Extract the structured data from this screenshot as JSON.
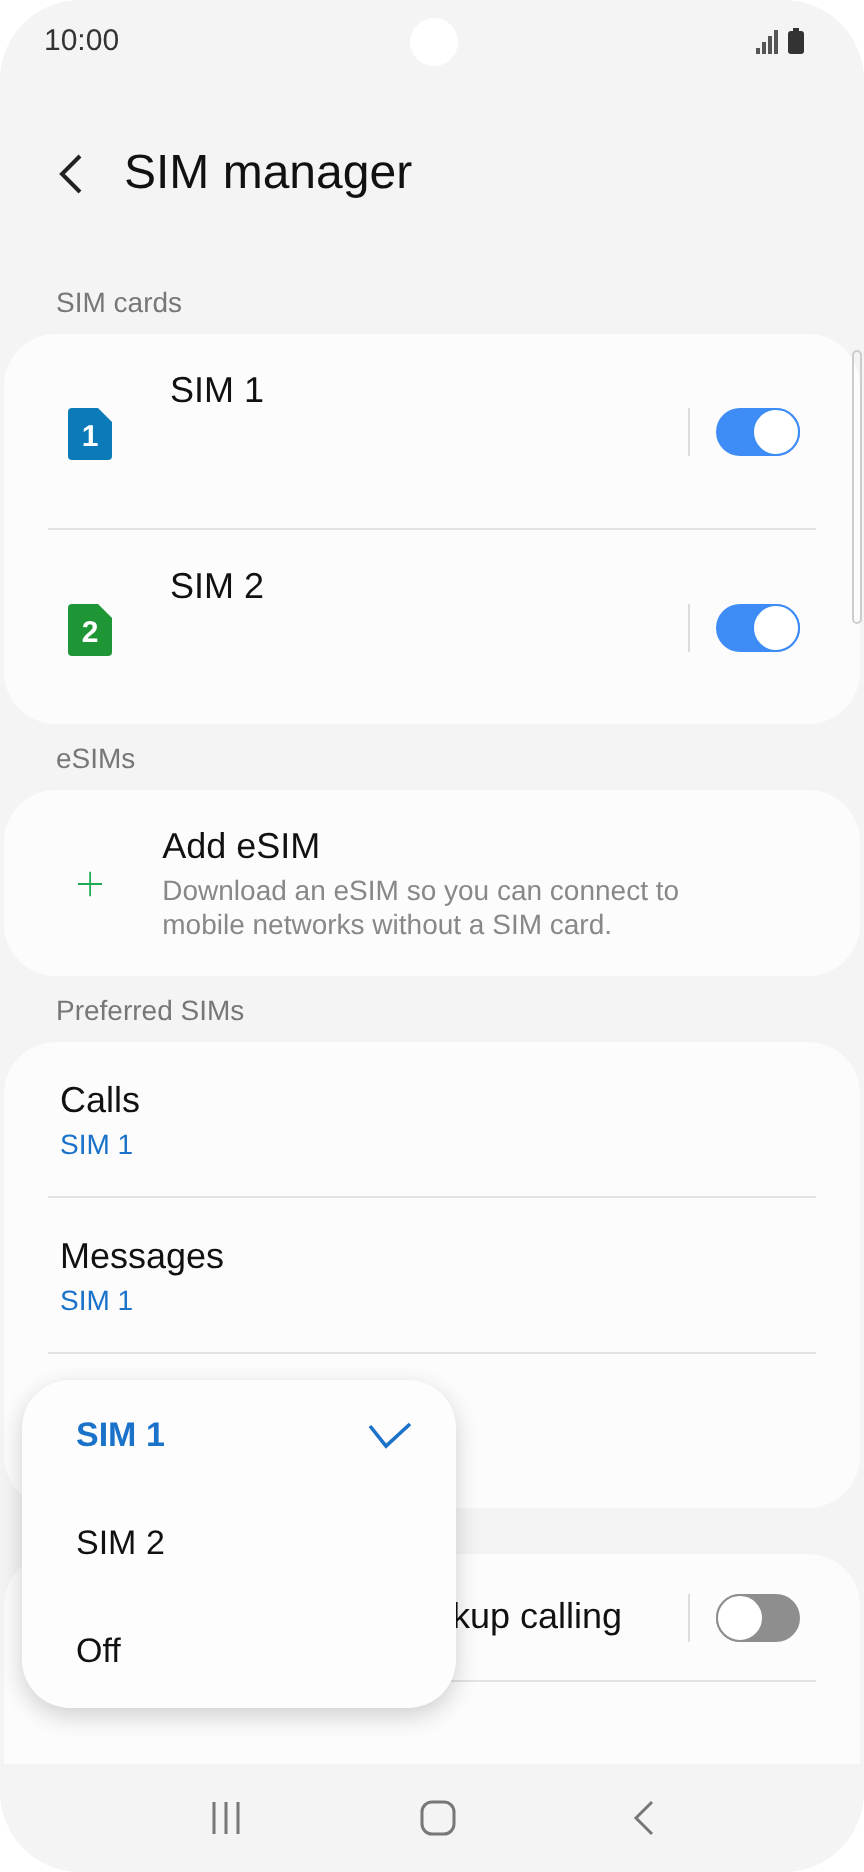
{
  "status_bar": {
    "time": "10:00"
  },
  "header": {
    "title": "SIM manager"
  },
  "sections": [
    {
      "label": "SIM cards",
      "rows": [
        {
          "kind": "sim",
          "badge": "1",
          "color": "#0a7bb8",
          "title": "SIM 1",
          "on": true
        },
        {
          "kind": "sim",
          "badge": "2",
          "color": "#1e9636",
          "title": "SIM 2",
          "on": true
        }
      ]
    },
    {
      "label": "eSIMs",
      "rows": [
        {
          "kind": "add",
          "title": "Add eSIM",
          "description": "Download an eSIM so you can connect to mobile networks without a SIM card."
        }
      ]
    },
    {
      "label": "Preferred SIMs",
      "rows": [
        {
          "kind": "choice",
          "title": "Calls",
          "value": "SIM 1"
        },
        {
          "kind": "choice",
          "title": "Messages",
          "value": "SIM 1"
        },
        {
          "kind": "hidden"
        }
      ]
    },
    {
      "rows": [
        {
          "kind": "switch",
          "title": "kup calling",
          "on": false
        },
        {
          "kind": "hidden"
        }
      ]
    }
  ],
  "menu": {
    "options": [
      {
        "label": "SIM 1",
        "selected": true
      },
      {
        "label": "SIM 2",
        "selected": false
      },
      {
        "label": "Off",
        "selected": false
      }
    ]
  }
}
